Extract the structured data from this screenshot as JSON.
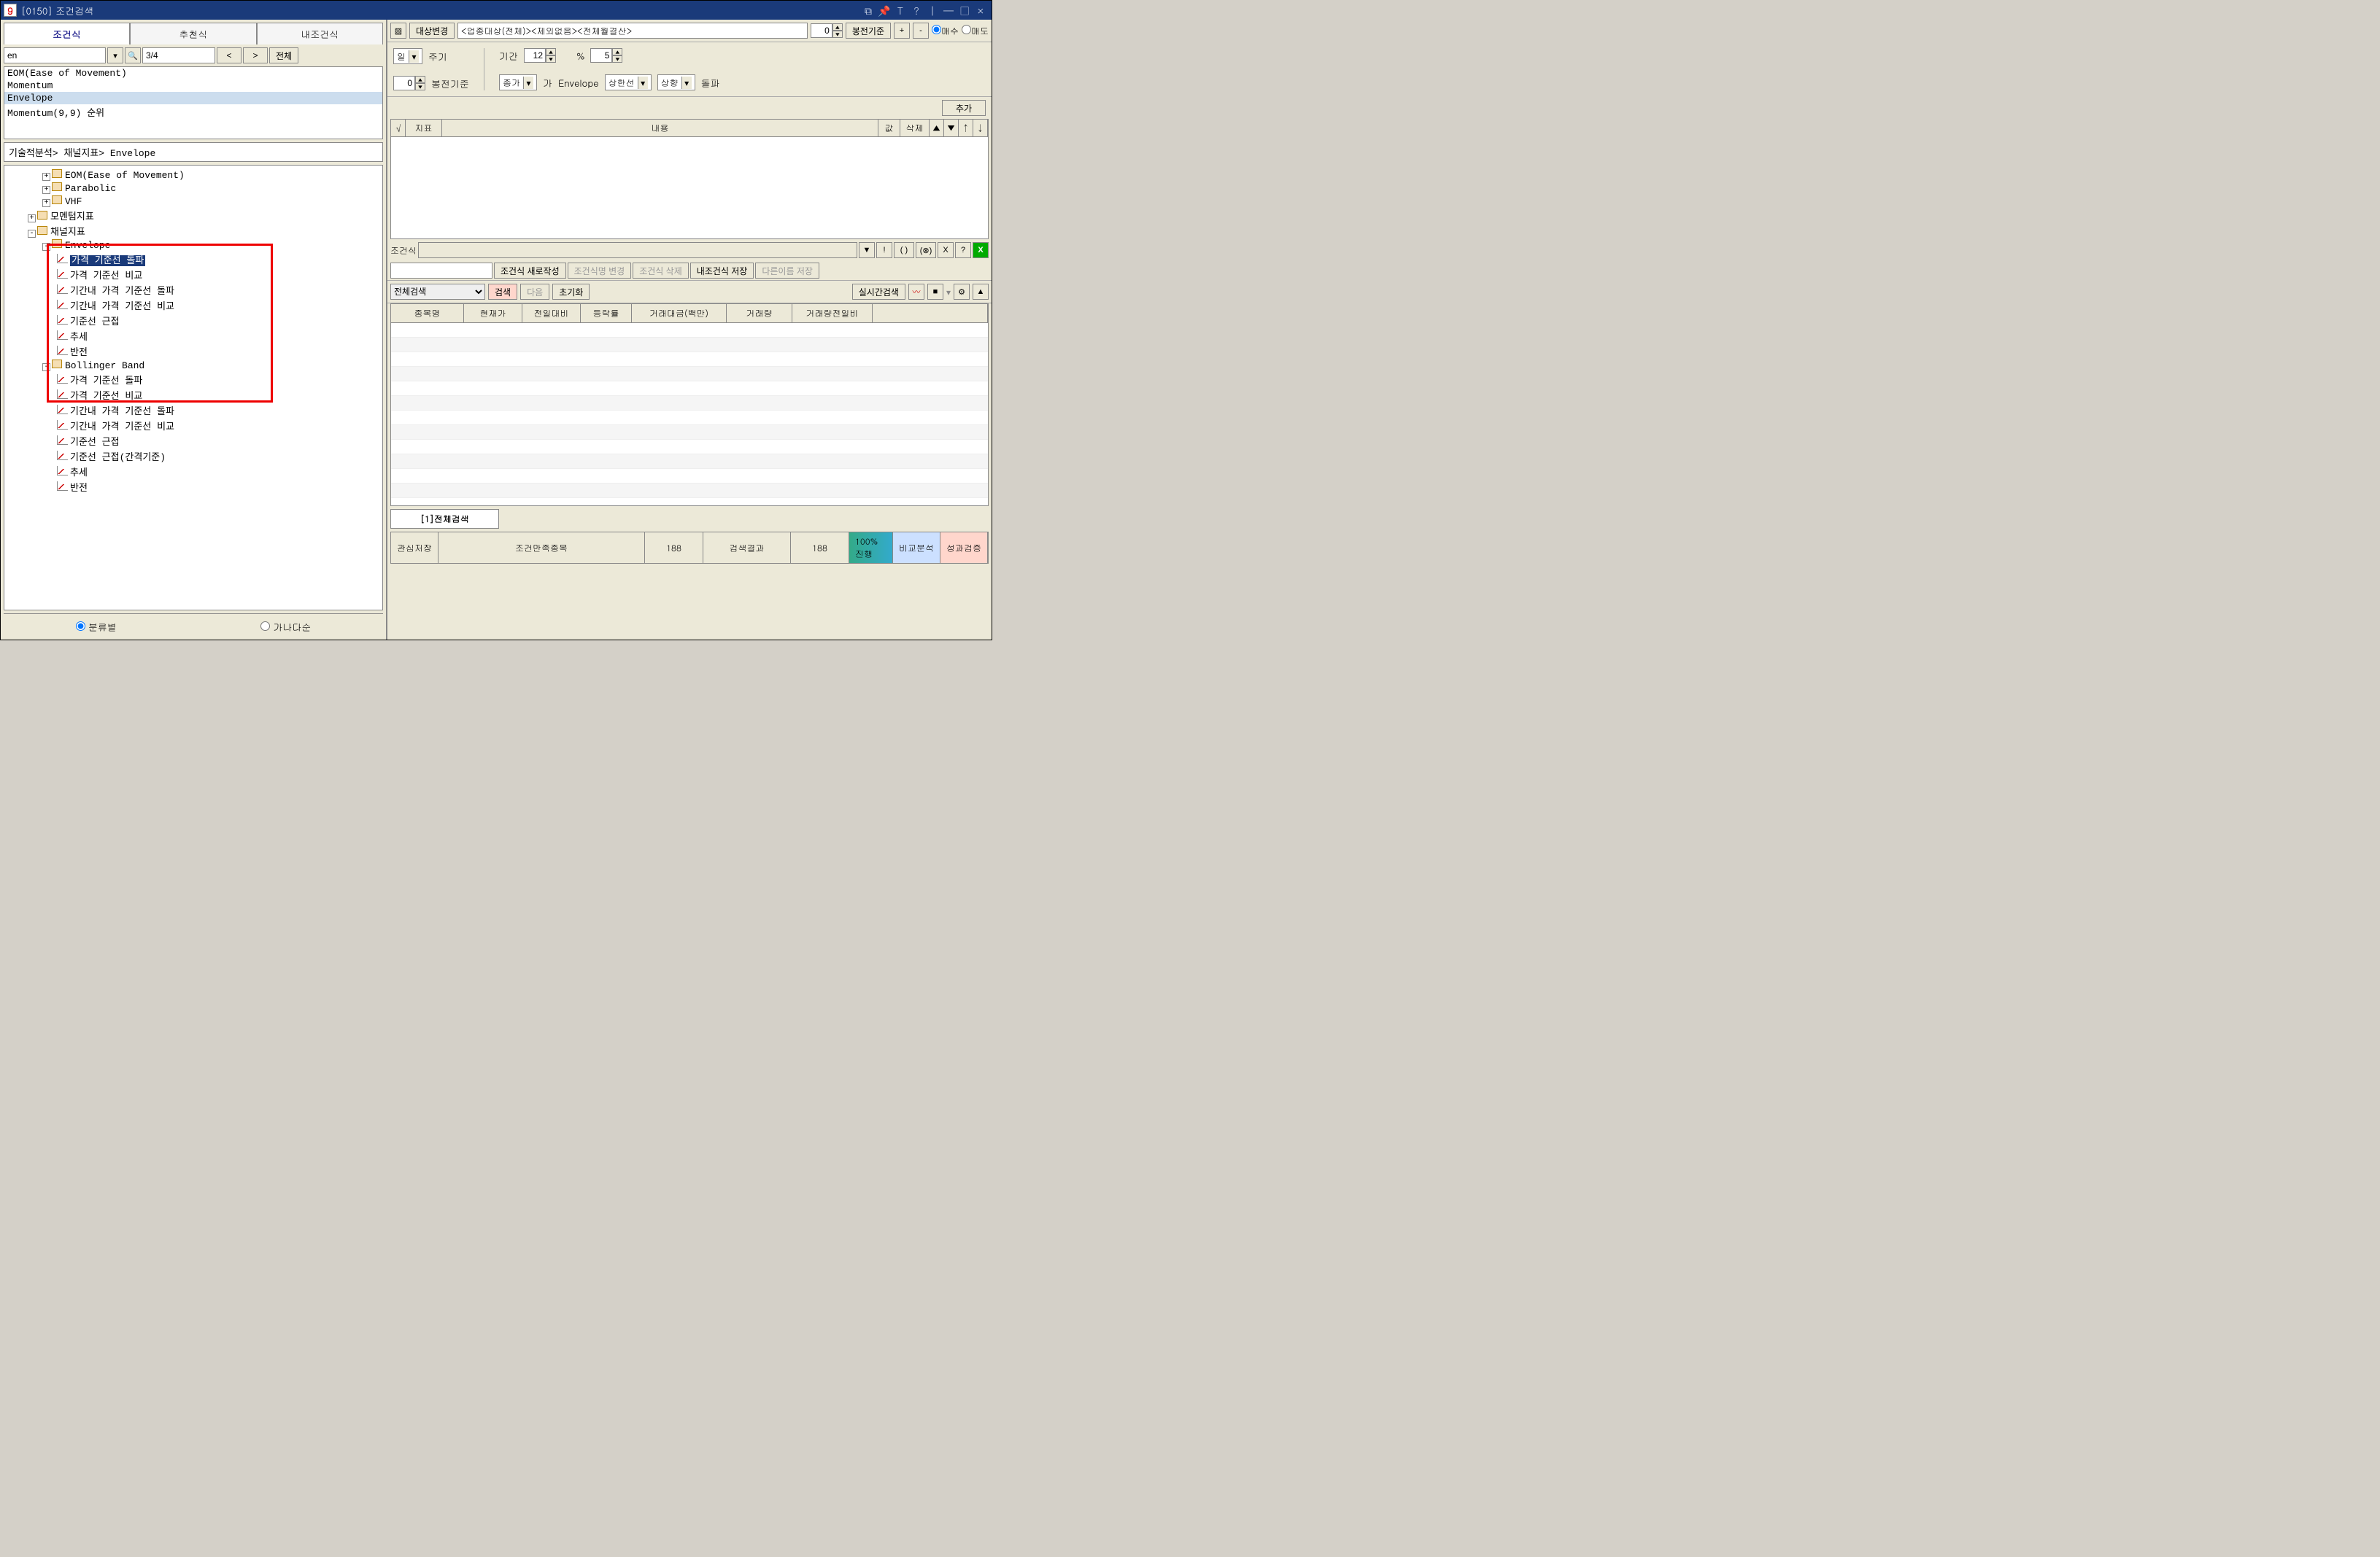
{
  "window": {
    "logo": "9",
    "title": "[0150] 조건검색"
  },
  "left": {
    "tabs": [
      "조건식",
      "추천식",
      "내조건식"
    ],
    "search_value": "en",
    "page": "3/4",
    "prev": "<",
    "next": ">",
    "all": "전체",
    "list": [
      "EOM(Ease of Movement)",
      "Momentum",
      "Envelope",
      "Momentum(9,9) 순위"
    ],
    "breadcrumb": "기술적분석> 채널지표> Envelope",
    "tree": {
      "n1": "EOM(Ease of Movement)",
      "n2": "Parabolic",
      "n3": "VHF",
      "n4": "모멘텀지표",
      "n5": "채널지표",
      "n6": "Envelope",
      "n6a": "가격 기준선 돌파",
      "n6b": "가격 기준선 비교",
      "n6c": "기간내 가격 기준선 돌파",
      "n6d": "기간내 가격 기준선 비교",
      "n6e": "기준선 근접",
      "n6f": "추세",
      "n6g": "반전",
      "n7": "Bollinger Band",
      "n7a": "가격 기준선 돌파",
      "n7b": "가격 기준선 비교",
      "n7c": "기간내 가격 기준선 돌파",
      "n7d": "기간내 가격 기준선 비교",
      "n7e": "기준선 근접",
      "n7f": "기준선 근접(간격기준)",
      "n7g": "추세",
      "n7h": "반전"
    },
    "sort": {
      "by_class": "분류별",
      "by_name": "가나다순"
    }
  },
  "right": {
    "target_btn": "대상변경",
    "target_field": "<업종대상(전체)><제외없음><전체월결산>",
    "target_num": "0",
    "bong_std": "봉전기준",
    "plus": "+",
    "minus": "-",
    "buy": "매수",
    "sell": "매도",
    "period_unit": "일",
    "period_lbl": "주기",
    "range_lbl": "기간",
    "range_val": "12",
    "pct": "%",
    "pct_val": "5",
    "bong_val": "0",
    "bong_lbl": "봉전기준",
    "close_sel": "종가",
    "ga": "가",
    "env": "Envelope",
    "upper": "상한선",
    "dir": "상향",
    "break": "돌파",
    "add": "추가",
    "cond_hdr": {
      "chk": "√",
      "ind": "지표",
      "content": "내용",
      "val": "값",
      "del": "삭제",
      "up": "▲",
      "dn": "▼",
      "u2": "↑",
      "d2": "↓"
    },
    "formula_lbl": "조건식",
    "formula_btns": [
      "▼",
      "!",
      "( )",
      "(⊗)",
      "X",
      "?"
    ],
    "excel_icon": "X",
    "new_cond": "조건식 새로작성",
    "rename": "조건식명 변경",
    "del_cond": "조건식 삭제",
    "save_mine": "내조건식 저장",
    "save_as": "다른이름 저장",
    "search_scope": "전체검색",
    "search": "검색",
    "next_btn": "다음",
    "reset": "초기화",
    "realtime": "실시간검색",
    "cols": [
      "종목명",
      "현재가",
      "전일대비",
      "등락률",
      "거래대금(백만)",
      "거래량",
      "거래량전일비"
    ],
    "result_tab": "[1]전체검색",
    "footer": {
      "wishlist": "관심저장",
      "match_lbl": "조건만족종목",
      "match_cnt": "188",
      "result_lbl": "검색결과",
      "result_cnt": "188",
      "progress": "100%진행",
      "compare": "비교분석",
      "verify": "성과검증"
    }
  }
}
